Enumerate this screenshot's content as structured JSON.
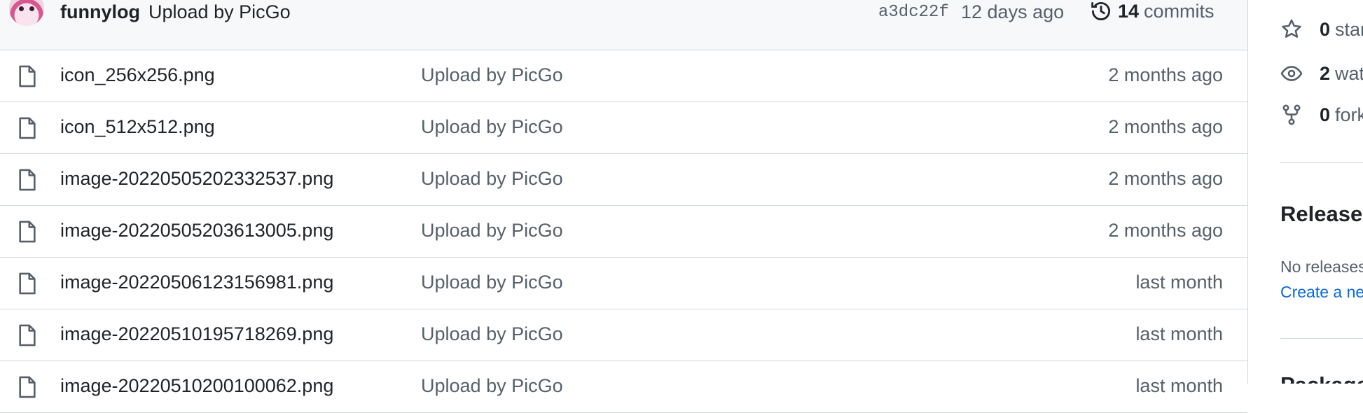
{
  "commit": {
    "author": "funnylog",
    "message": "Upload by PicGo",
    "sha": "a3dc22f",
    "time": "12 days ago",
    "commits_count": "14",
    "commits_label": "commits"
  },
  "files": [
    {
      "name": "icon_256x256.png",
      "message": "Upload by PicGo",
      "age": "2 months ago"
    },
    {
      "name": "icon_512x512.png",
      "message": "Upload by PicGo",
      "age": "2 months ago"
    },
    {
      "name": "image-20220505202332537.png",
      "message": "Upload by PicGo",
      "age": "2 months ago"
    },
    {
      "name": "image-20220505203613005.png",
      "message": "Upload by PicGo",
      "age": "2 months ago"
    },
    {
      "name": "image-20220506123156981.png",
      "message": "Upload by PicGo",
      "age": "last month"
    },
    {
      "name": "image-20220510195718269.png",
      "message": "Upload by PicGo",
      "age": "last month"
    },
    {
      "name": "image-20220510200100062.png",
      "message": "Upload by PicGo",
      "age": "last month"
    }
  ],
  "sidebar": {
    "stars": {
      "count": "0",
      "label": "stars",
      "icon": "star-icon"
    },
    "watching": {
      "count": "2",
      "label": "watching",
      "icon": "eye-icon"
    },
    "forks": {
      "count": "0",
      "label": "forks",
      "icon": "fork-icon"
    },
    "releases_title": "Releases",
    "releases_none": "No releases published",
    "releases_link": "Create a new release",
    "packages_title": "Packages"
  },
  "colors": {
    "link": "#0969da",
    "muted": "#57606a",
    "border": "#d0d7de",
    "header_bg": "#f6f8fa"
  }
}
